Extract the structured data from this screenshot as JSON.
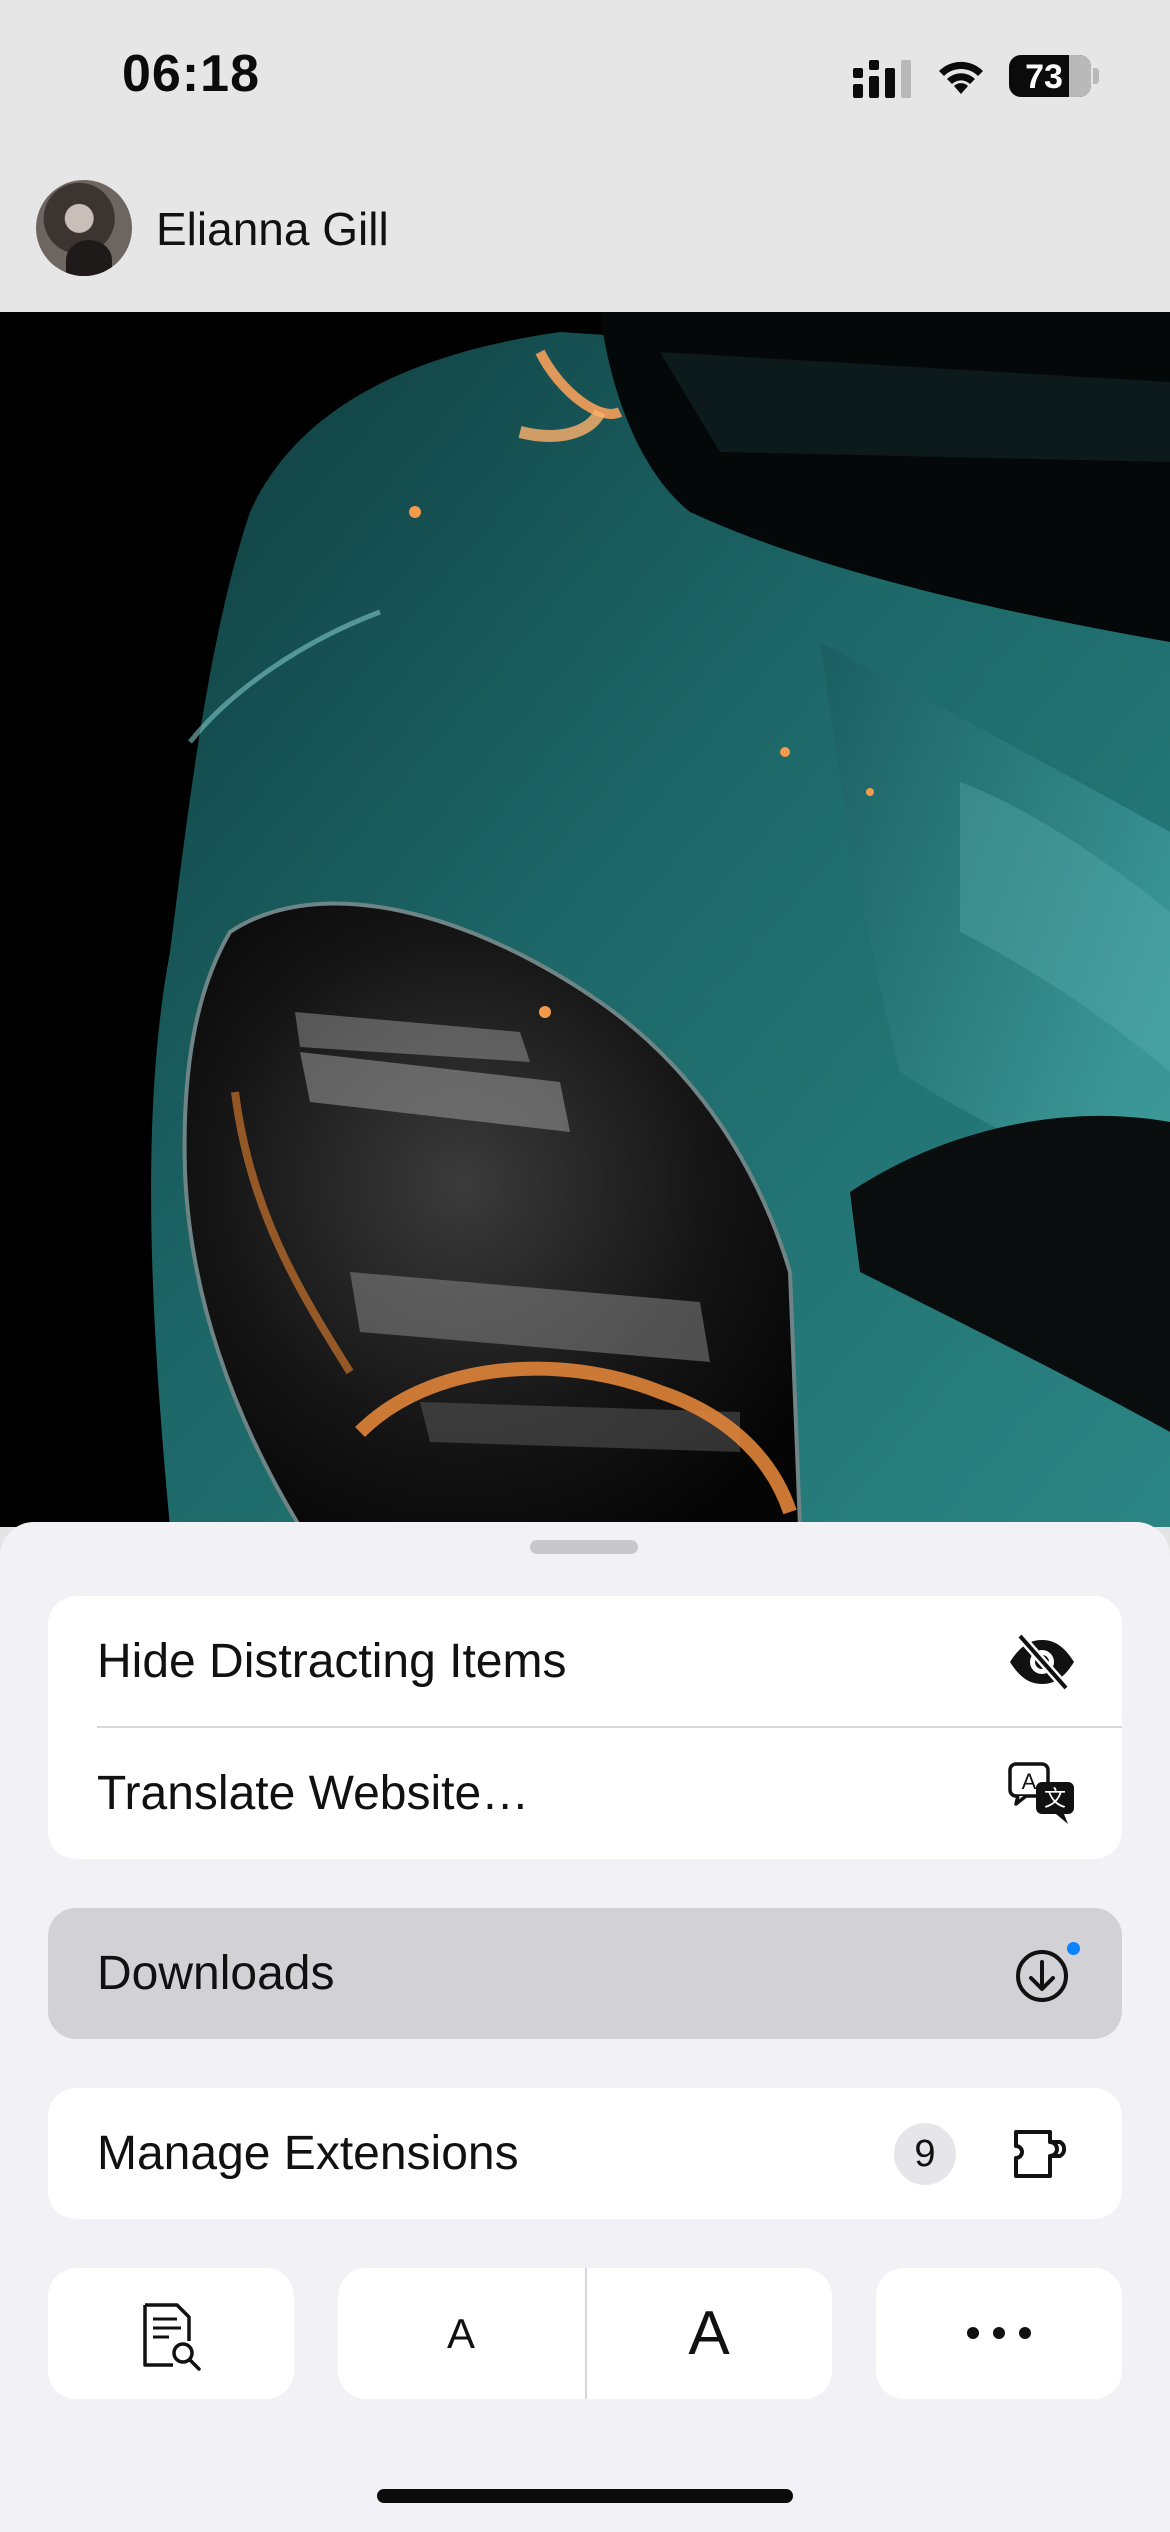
{
  "status_bar": {
    "time": "06:18",
    "battery_percent": "73",
    "signal_icon": "cellular-signal-icon",
    "wifi_icon": "wifi-icon"
  },
  "profile": {
    "name": "Elianna Gill"
  },
  "menu": {
    "group1": [
      {
        "label": "Hide Distracting Items",
        "icon": "eye-slash-icon"
      },
      {
        "label": "Translate Website…",
        "icon": "translate-icon"
      }
    ],
    "downloads": {
      "label": "Downloads",
      "icon": "download-circle-icon",
      "has_indicator": true,
      "indicator_color": "#0a84ff"
    },
    "extensions": {
      "label": "Manage Extensions",
      "count": "9",
      "icon": "puzzle-icon"
    }
  },
  "toolbar": {
    "find_icon": "find-on-page-icon",
    "text_smaller_label": "A",
    "text_larger_label": "A",
    "more_label": "•••"
  },
  "colors": {
    "accent": "#0a84ff",
    "sheet_background": "#f2f2f6",
    "highlight_row": "#d1d1d6",
    "car_teal": "#1f6a6a"
  }
}
